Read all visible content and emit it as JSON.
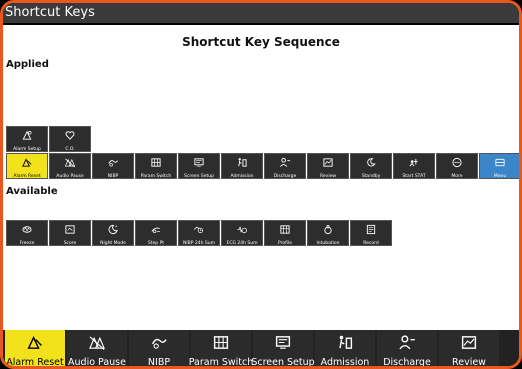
{
  "window": {
    "title": "Shortcut Keys"
  },
  "dialog": {
    "heading": "Shortcut Key Sequence",
    "applied_label": "Applied",
    "available_label": "Available"
  },
  "applied_row1": [
    {
      "label": "Alarm Setup",
      "icon": "alarm-setup-icon"
    },
    {
      "label": "C.O.",
      "icon": "heart-icon"
    }
  ],
  "applied_row2": [
    {
      "label": "Alarm Reset",
      "icon": "alarm-reset-icon",
      "state": "active"
    },
    {
      "label": "Audio Pause",
      "icon": "audio-pause-icon"
    },
    {
      "label": "NIBP",
      "icon": "nibp-icon"
    },
    {
      "label": "Param Switch",
      "icon": "param-switch-icon"
    },
    {
      "label": "Screen Setup",
      "icon": "screen-setup-icon"
    },
    {
      "label": "Admission",
      "icon": "admission-icon"
    },
    {
      "label": "Discharge",
      "icon": "discharge-icon"
    },
    {
      "label": "Review",
      "icon": "review-icon"
    },
    {
      "label": "Standby",
      "icon": "standby-icon"
    },
    {
      "label": "Start STAT",
      "icon": "start-stat-icon"
    },
    {
      "label": "More",
      "icon": "more-icon"
    },
    {
      "label": "Menu",
      "icon": "menu-icon",
      "state": "blue"
    }
  ],
  "available_row": [
    {
      "label": "Freeze",
      "icon": "freeze-icon"
    },
    {
      "label": "Score",
      "icon": "score-icon"
    },
    {
      "label": "Night Mode",
      "icon": "night-mode-icon"
    },
    {
      "label": "Step Pt",
      "icon": "step-icon"
    },
    {
      "label": "NIBP 24h Sum",
      "icon": "nibp-sum-icon"
    },
    {
      "label": "ECG 24h Sum",
      "icon": "ecg-sum-icon"
    },
    {
      "label": "Profile",
      "icon": "profile-icon"
    },
    {
      "label": "Intubation",
      "icon": "intubation-icon"
    },
    {
      "label": "Record",
      "icon": "record-icon"
    }
  ],
  "bottom_bar": [
    {
      "label": "Alarm Reset",
      "icon": "alarm-reset-icon",
      "state": "active"
    },
    {
      "label": "Audio Pause",
      "icon": "audio-pause-icon"
    },
    {
      "label": "NIBP",
      "icon": "nibp-icon"
    },
    {
      "label": "Param Switch",
      "icon": "param-switch-icon"
    },
    {
      "label": "Screen Setup",
      "icon": "screen-setup-icon"
    },
    {
      "label": "Admission",
      "icon": "admission-icon"
    },
    {
      "label": "Discharge",
      "icon": "discharge-icon"
    },
    {
      "label": "Review",
      "icon": "review-icon"
    }
  ],
  "colors": {
    "frame": "#e8571e",
    "active": "#f2e21c",
    "menu_blue": "#3b86c8",
    "key_bg": "#2d2d2d"
  }
}
